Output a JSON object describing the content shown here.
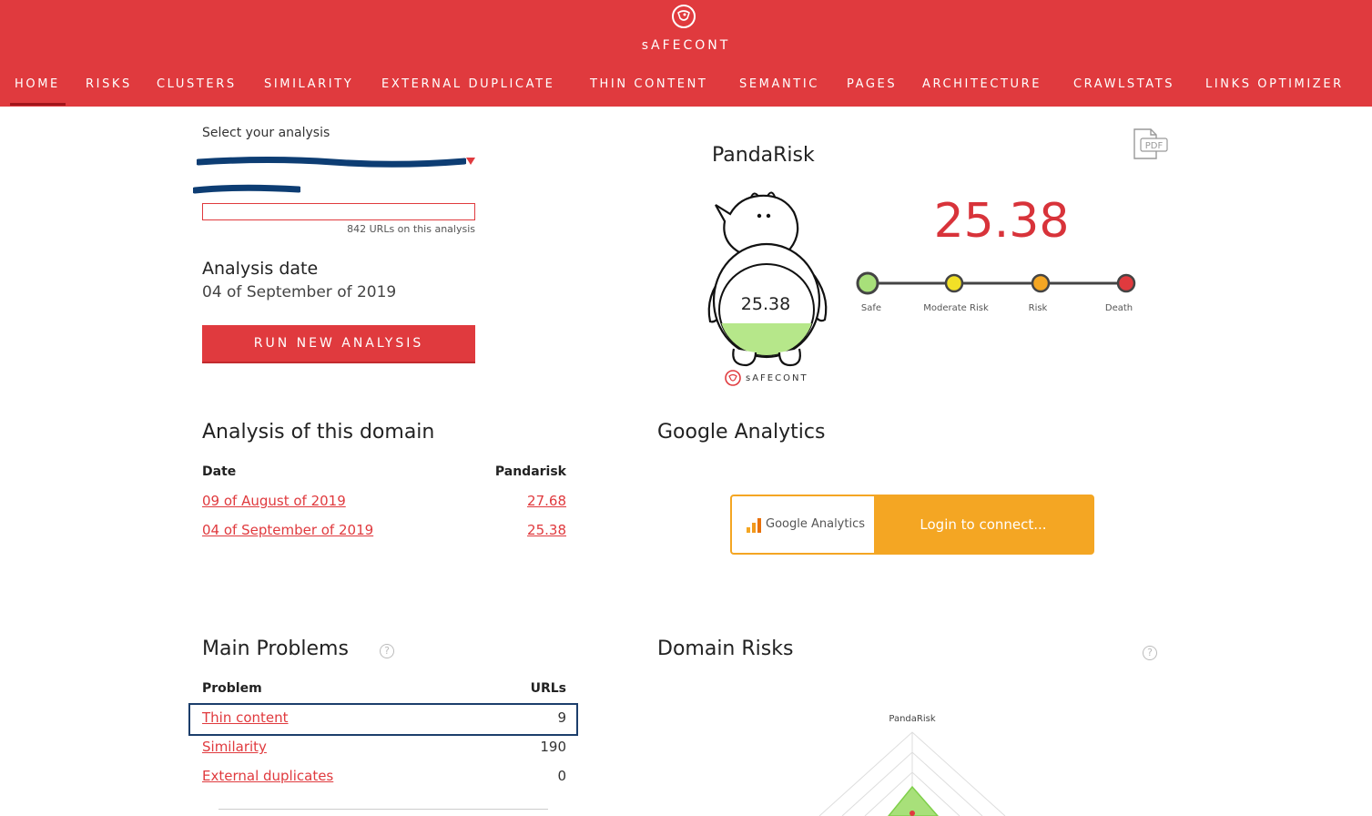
{
  "brand": {
    "name": "sAFECONT",
    "accent": "#e03a3e"
  },
  "nav": {
    "items": [
      {
        "label": "HOME",
        "active": true
      },
      {
        "label": "RISKS"
      },
      {
        "label": "CLUSTERS"
      },
      {
        "label": "SIMILARITY"
      },
      {
        "label": "EXTERNAL DUPLICATE"
      },
      {
        "label": "THIN CONTENT"
      },
      {
        "label": "SEMANTIC"
      },
      {
        "label": "PAGES"
      },
      {
        "label": "ARCHITECTURE"
      },
      {
        "label": "CRAWLSTATS"
      },
      {
        "label": "LINKS OPTIMIZER"
      }
    ]
  },
  "analysis": {
    "select_label": "Select your analysis",
    "url_count": "842 URLs on this analysis",
    "date_label": "Analysis date",
    "date_value": "04 of September of 2019",
    "run_button": "RUN NEW ANALYSIS"
  },
  "pandarisk": {
    "title": "PandaRisk",
    "score": "25.38",
    "mini_logo": "sAFECONT",
    "scale": [
      "Safe",
      "Moderate Risk",
      "Risk",
      "Death"
    ],
    "scale_colors": [
      "#a8e07a",
      "#f2e027",
      "#f4a623",
      "#e03a3e"
    ],
    "pdf_label": "PDF"
  },
  "domain_analysis": {
    "title": "Analysis of this domain",
    "col_date": "Date",
    "col_pandarisk": "Pandarisk",
    "rows": [
      {
        "date": "09 of August of 2019",
        "value": "27.68"
      },
      {
        "date": "04 of September of 2019",
        "value": "25.38"
      }
    ]
  },
  "google_analytics": {
    "title": "Google Analytics",
    "brand": "Google Analytics",
    "login": "Login to connect..."
  },
  "main_problems": {
    "title": "Main Problems",
    "col_problem": "Problem",
    "col_urls": "URLs",
    "rows": [
      {
        "problem": "Thin content",
        "urls": "9"
      },
      {
        "problem": "Similarity",
        "urls": "190"
      },
      {
        "problem": "External duplicates",
        "urls": "0"
      }
    ]
  },
  "domain_risks": {
    "title": "Domain Risks",
    "radar_top_label": "PandaRisk"
  },
  "help_glyph": "?"
}
